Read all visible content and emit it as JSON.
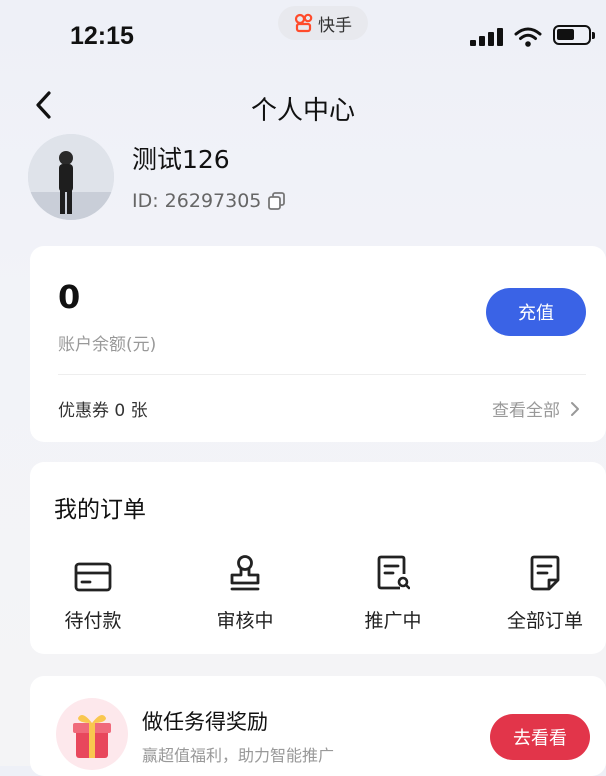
{
  "status_bar": {
    "time": "12:15",
    "app_name": "快手"
  },
  "nav": {
    "title": "个人中心"
  },
  "profile": {
    "username": "测试126",
    "id_text": "ID: 26297305"
  },
  "balance": {
    "amount": "0",
    "label": "账户余额(元)",
    "recharge_label": "充值",
    "coupon_text": "优惠券 0 张",
    "view_all_label": "查看全部"
  },
  "orders": {
    "title": "我的订单",
    "items": [
      {
        "label": "待付款",
        "icon": "card-icon"
      },
      {
        "label": "审核中",
        "icon": "stamp-icon"
      },
      {
        "label": "推广中",
        "icon": "document-search-icon"
      },
      {
        "label": "全部订单",
        "icon": "document-icon"
      }
    ]
  },
  "task": {
    "title": "做任务得奖励",
    "subtitle": "赢超值福利，助力智能推广",
    "button_label": "去看看"
  },
  "colors": {
    "primary_blue": "#3a63e6",
    "accent_red": "#e2354a"
  }
}
